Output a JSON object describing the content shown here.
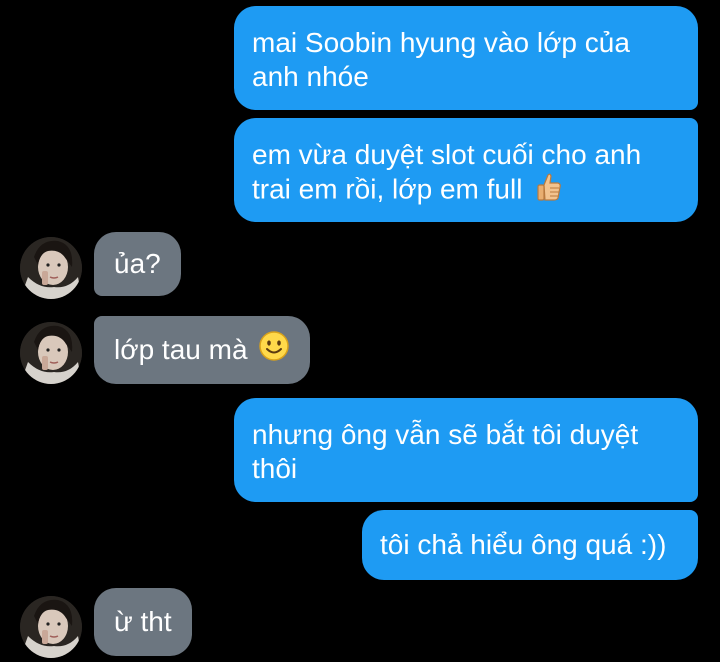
{
  "messages": [
    {
      "side": "sent",
      "text_line1": "mai Soobin hyung vào lớp của",
      "text_line2": "anh nhóe"
    },
    {
      "side": "sent",
      "text_line1": "em vừa duyệt slot cuối cho anh",
      "text_line2": "trai em rồi, lớp em full",
      "emoji": "thumbs-up-icon"
    },
    {
      "side": "received",
      "text": "ủa?"
    },
    {
      "side": "received",
      "text": "lớp tau mà",
      "emoji": "smiley-icon"
    },
    {
      "side": "sent",
      "text_line1": "nhưng ông vẫn sẽ bắt tôi duyệt",
      "text_line2": "thôi"
    },
    {
      "side": "sent",
      "text": "tôi chả hiểu ông quá :))"
    },
    {
      "side": "received",
      "text": "ừ tht"
    }
  ],
  "colors": {
    "background": "#000000",
    "sent_bubble": "#1e9bf3",
    "received_bubble": "#6c7680",
    "text": "#ffffff"
  }
}
